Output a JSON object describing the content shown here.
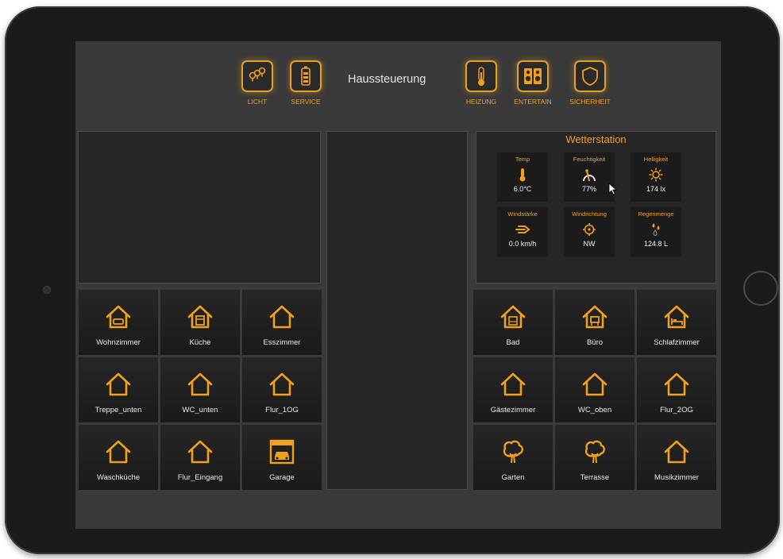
{
  "app": {
    "title": "Haussteuerung"
  },
  "nav": {
    "licht": "LICHT",
    "service": "SERVICE",
    "heizung": "HEIZUNG",
    "entertain": "ENTERTAIN",
    "sicherheit": "SICHERHEIT"
  },
  "weather": {
    "title": "Wetterstation",
    "temp_label": "Temp",
    "temp_value": "6.0°C",
    "humidity_label": "Feuchtigkeit",
    "humidity_value": "77%",
    "brightness_label": "Helligkeit",
    "brightness_value": "174 lx",
    "windspeed_label": "Windstärke",
    "windspeed_value": "0.0 km/h",
    "winddir_label": "Windrichtung",
    "winddir_value": "NW",
    "rain_label": "Regenmenge",
    "rain_value": "124.8 L"
  },
  "rooms_left": [
    "Wohnzimmer",
    "Küche",
    "Esszimmer",
    "Treppe_unten",
    "WC_unten",
    "Flur_1OG",
    "Waschküche",
    "Flur_Eingang",
    "Garage"
  ],
  "rooms_right": [
    "Bad",
    "Büro",
    "Schlafzimmer",
    "Gästezimmer",
    "WC_oben",
    "Flur_2OG",
    "Garten",
    "Terrasse",
    "Musikzimmer"
  ],
  "colors": {
    "accent": "#f0a020",
    "background": "#3a3a3a",
    "tile": "#1f1f1f"
  }
}
